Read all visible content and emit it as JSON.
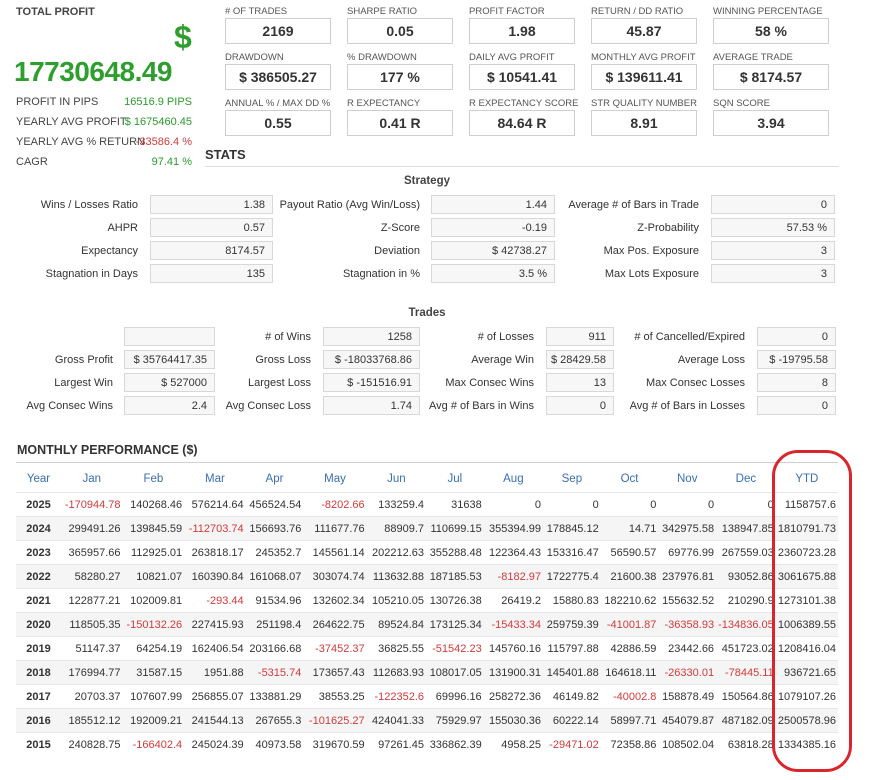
{
  "summary": {
    "total_profit_label": "TOTAL PROFIT",
    "currency_symbol": "$",
    "total_profit": "17730648.49",
    "left_stats": [
      {
        "label": "PROFIT IN PIPS",
        "value": "16516.9 PIPS",
        "color": "green"
      },
      {
        "label": "YEARLY AVG PROFIT",
        "value": "$ 1675460.45",
        "color": "green"
      },
      {
        "label": "YEARLY AVG % RETURN",
        "value": "-33586.4 %",
        "color": "red"
      },
      {
        "label": "CAGR",
        "value": "97.41 %",
        "color": "green"
      }
    ]
  },
  "metrics": [
    [
      {
        "label": "# OF TRADES",
        "value": "2169"
      },
      {
        "label": "SHARPE RATIO",
        "value": "0.05"
      },
      {
        "label": "PROFIT FACTOR",
        "value": "1.98"
      },
      {
        "label": "RETURN / DD RATIO",
        "value": "45.87"
      },
      {
        "label": "WINNING PERCENTAGE",
        "value": "58 %"
      }
    ],
    [
      {
        "label": "DRAWDOWN",
        "value": "$ 386505.27"
      },
      {
        "label": "% DRAWDOWN",
        "value": "177 %"
      },
      {
        "label": "DAILY AVG PROFIT",
        "value": "$ 10541.41"
      },
      {
        "label": "MONTHLY AVG PROFIT",
        "value": "$ 139611.41"
      },
      {
        "label": "AVERAGE TRADE",
        "value": "$ 8174.57"
      }
    ],
    [
      {
        "label": "ANNUAL % / MAX DD %",
        "value": "0.55"
      },
      {
        "label": "R EXPECTANCY",
        "value": "0.41 R"
      },
      {
        "label": "R EXPECTANCY SCORE",
        "value": "84.64 R"
      },
      {
        "label": "STR QUALITY NUMBER",
        "value": "8.91"
      },
      {
        "label": "SQN SCORE",
        "value": "3.94"
      }
    ]
  ],
  "stats_title": "STATS",
  "strategy": {
    "title": "Strategy",
    "rows": [
      [
        {
          "label": "Wins / Losses Ratio",
          "value": "1.38"
        },
        {
          "label": "Payout Ratio (Avg Win/Loss)",
          "value": "1.44"
        },
        {
          "label": "Average # of Bars in Trade",
          "value": "0"
        }
      ],
      [
        {
          "label": "AHPR",
          "value": "0.57"
        },
        {
          "label": "Z-Score",
          "value": "-0.19"
        },
        {
          "label": "Z-Probability",
          "value": "57.53 %"
        }
      ],
      [
        {
          "label": "Expectancy",
          "value": "8174.57"
        },
        {
          "label": "Deviation",
          "value": "$ 42738.27"
        },
        {
          "label": "Max Pos. Exposure",
          "value": "3"
        }
      ],
      [
        {
          "label": "Stagnation in Days",
          "value": "135"
        },
        {
          "label": "Stagnation in %",
          "value": "3.5 %"
        },
        {
          "label": "Max Lots Exposure",
          "value": "3"
        }
      ]
    ]
  },
  "trades": {
    "title": "Trades",
    "rows": [
      [
        {
          "label": "",
          "value": ""
        },
        {
          "label": "# of Wins",
          "value": "1258"
        },
        {
          "label": "# of Losses",
          "value": "911"
        },
        {
          "label": "# of Cancelled/Expired",
          "value": "0"
        }
      ],
      [
        {
          "label": "Gross Profit",
          "value": "$ 35764417.35"
        },
        {
          "label": "Gross Loss",
          "value": "$ -18033768.86"
        },
        {
          "label": "Average Win",
          "value": "$ 28429.58"
        },
        {
          "label": "Average Loss",
          "value": "$ -19795.58"
        }
      ],
      [
        {
          "label": "Largest Win",
          "value": "$ 527000"
        },
        {
          "label": "Largest Loss",
          "value": "$ -151516.91"
        },
        {
          "label": "Max Consec Wins",
          "value": "13"
        },
        {
          "label": "Max Consec Losses",
          "value": "8"
        }
      ],
      [
        {
          "label": "Avg Consec Wins",
          "value": "2.4"
        },
        {
          "label": "Avg Consec Loss",
          "value": "1.74"
        },
        {
          "label": "Avg # of Bars in Wins",
          "value": "0"
        },
        {
          "label": "Avg # of Bars in Losses",
          "value": "0"
        }
      ]
    ]
  },
  "monthly": {
    "title": "MONTHLY PERFORMANCE ($)",
    "headers": [
      "Year",
      "Jan",
      "Feb",
      "Mar",
      "Apr",
      "May",
      "Jun",
      "Jul",
      "Aug",
      "Sep",
      "Oct",
      "Nov",
      "Dec",
      "YTD"
    ],
    "rows": [
      [
        "2025",
        "-170944.78",
        "140268.46",
        "576214.64",
        "456524.54",
        "-8202.66",
        "133259.4",
        "31638",
        "0",
        "0",
        "0",
        "0",
        "0",
        "1158757.6"
      ],
      [
        "2024",
        "299491.26",
        "139845.59",
        "-112703.74",
        "156693.76",
        "111677.76",
        "88909.7",
        "110699.15",
        "355394.99",
        "178845.12",
        "14.71",
        "342975.58",
        "138947.85",
        "1810791.73"
      ],
      [
        "2023",
        "365957.66",
        "112925.01",
        "263818.17",
        "245352.7",
        "145561.14",
        "202212.63",
        "355288.48",
        "122364.43",
        "153316.47",
        "56590.57",
        "69776.99",
        "267559.03",
        "2360723.28"
      ],
      [
        "2022",
        "58280.27",
        "10821.07",
        "160390.84",
        "161068.07",
        "303074.74",
        "113632.88",
        "187185.53",
        "-8182.97",
        "1722775.4",
        "21600.38",
        "237976.81",
        "93052.86",
        "3061675.88"
      ],
      [
        "2021",
        "122877.21",
        "102009.81",
        "-293.44",
        "91534.96",
        "132602.34",
        "105210.05",
        "130726.38",
        "26419.2",
        "15880.83",
        "182210.62",
        "155632.52",
        "210290.9",
        "1273101.38"
      ],
      [
        "2020",
        "118505.35",
        "-150132.26",
        "227415.93",
        "251198.4",
        "264622.75",
        "89524.84",
        "173125.34",
        "-15433.34",
        "259759.39",
        "-41001.87",
        "-36358.93",
        "-134836.05",
        "1006389.55"
      ],
      [
        "2019",
        "51147.37",
        "64254.19",
        "162406.54",
        "203166.68",
        "-37452.37",
        "36825.55",
        "-51542.23",
        "145760.16",
        "115797.88",
        "42886.59",
        "23442.66",
        "451723.02",
        "1208416.04"
      ],
      [
        "2018",
        "176994.77",
        "31587.15",
        "1951.88",
        "-5315.74",
        "173657.43",
        "112683.93",
        "108017.05",
        "131900.31",
        "145401.88",
        "164618.11",
        "-26330.01",
        "-78445.11",
        "936721.65"
      ],
      [
        "2017",
        "20703.37",
        "107607.99",
        "256855.07",
        "133881.29",
        "38553.25",
        "-122352.6",
        "69996.16",
        "258272.36",
        "46149.82",
        "-40002.8",
        "158878.49",
        "150564.86",
        "1079107.26"
      ],
      [
        "2016",
        "185512.12",
        "192009.21",
        "241544.13",
        "267655.3",
        "-101625.27",
        "424041.33",
        "75929.97",
        "155030.36",
        "60222.14",
        "58997.71",
        "454079.87",
        "487182.09",
        "2500578.96"
      ],
      [
        "2015",
        "240828.75",
        "-166402.4",
        "245024.39",
        "40973.58",
        "319670.59",
        "97261.45",
        "336862.39",
        "4958.25",
        "-29471.02",
        "72358.86",
        "108502.04",
        "63818.28",
        "1334385.16"
      ]
    ]
  },
  "colors": {
    "positive": "#2a9a2a",
    "negative": "#d23a3a",
    "header_blue": "#3a6fb0",
    "highlight": "#d9262c"
  }
}
